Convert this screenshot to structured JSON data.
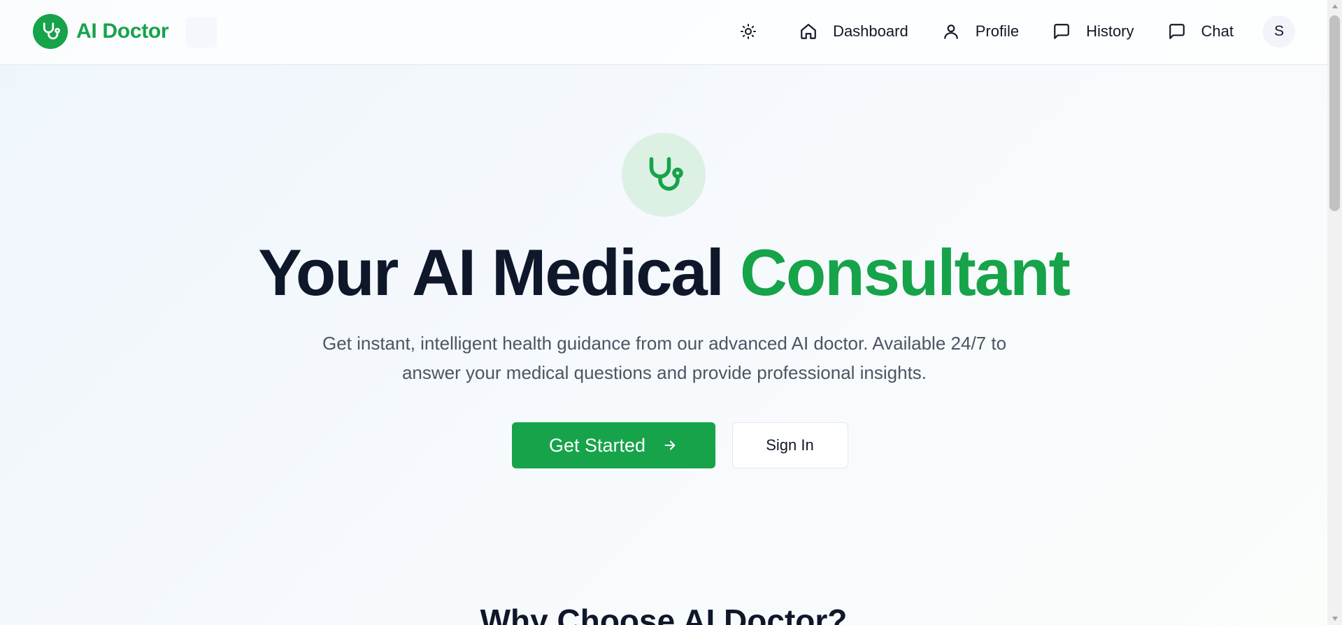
{
  "header": {
    "brand": "AI Doctor",
    "nav": [
      {
        "icon": "home-icon",
        "label": "Dashboard"
      },
      {
        "icon": "user-icon",
        "label": "Profile"
      },
      {
        "icon": "message-icon",
        "label": "History"
      },
      {
        "icon": "message-icon",
        "label": "Chat"
      }
    ],
    "theme_icon": "sun-icon",
    "avatar_initial": "S"
  },
  "hero": {
    "icon": "stethoscope-icon",
    "title_main": "Your AI Medical ",
    "title_accent": "Consultant",
    "subtitle": "Get instant, intelligent health guidance from our advanced AI doctor. Available 24/7 to answer your medical questions and provide professional insights.",
    "primary_cta": "Get Started",
    "secondary_cta": "Sign In"
  },
  "features": {
    "title": "Why Choose AI Doctor?"
  },
  "colors": {
    "accent": "#16a34a",
    "heading": "#0f172a",
    "body_text": "#4b5563"
  }
}
